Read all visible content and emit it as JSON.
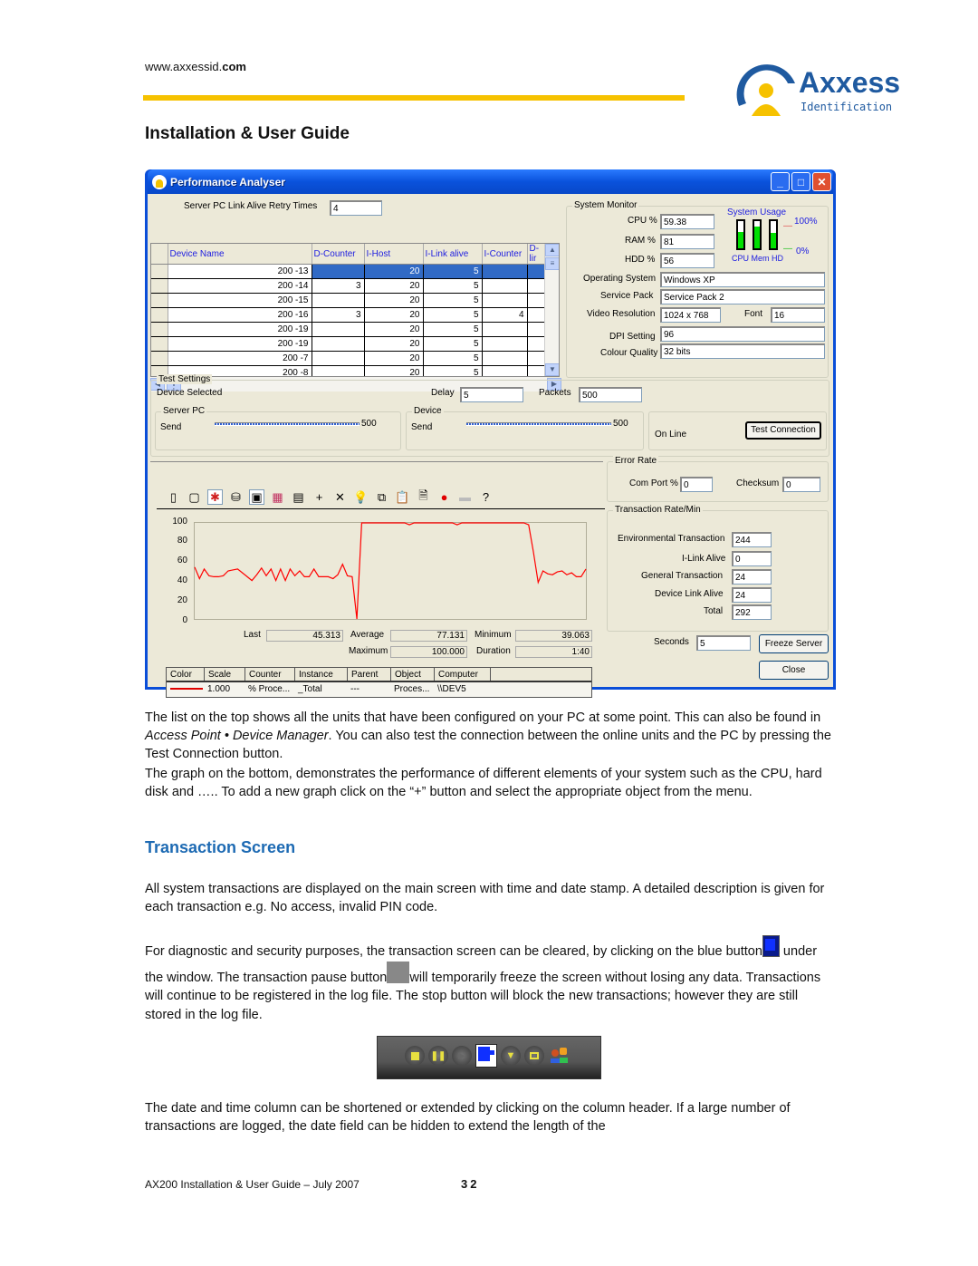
{
  "header": {
    "url_prefix": "www.axxessid.",
    "url_suffix": "com",
    "logo_name": "Axxess",
    "logo_sub": "Identification",
    "section_title": "Installation & User Guide"
  },
  "window": {
    "title": "Performance Analyser",
    "link_alive_label": "Server PC  Link Alive Retry Times",
    "link_alive_value": "4",
    "grid": {
      "columns": [
        "Device Name",
        "D-Counter",
        "I-Host",
        "I-Link alive",
        "I-Counter",
        "D-lir"
      ],
      "rows": [
        {
          "name": "200 -13",
          "d_counter": "",
          "i_host": "20",
          "i_link": "5",
          "i_counter": "",
          "selected": true
        },
        {
          "name": "200 -14",
          "d_counter": "3",
          "i_host": "20",
          "i_link": "5",
          "i_counter": ""
        },
        {
          "name": "200 -15",
          "d_counter": "",
          "i_host": "20",
          "i_link": "5",
          "i_counter": ""
        },
        {
          "name": "200 -16",
          "d_counter": "3",
          "i_host": "20",
          "i_link": "5",
          "i_counter": "4"
        },
        {
          "name": "200 -19",
          "d_counter": "",
          "i_host": "20",
          "i_link": "5",
          "i_counter": ""
        },
        {
          "name": "200 -19",
          "d_counter": "",
          "i_host": "20",
          "i_link": "5",
          "i_counter": ""
        },
        {
          "name": "200 -7",
          "d_counter": "",
          "i_host": "20",
          "i_link": "5",
          "i_counter": ""
        },
        {
          "name": "200 -8",
          "d_counter": "",
          "i_host": "20",
          "i_link": "5",
          "i_counter": ""
        }
      ]
    },
    "system_monitor": {
      "title": "System Monitor",
      "cpu_label": "CPU %",
      "cpu_value": "59.38",
      "ram_label": "RAM %",
      "ram_value": "81",
      "hdd_label": "HDD %",
      "hdd_value": "56",
      "os_label": "Operating System",
      "os_value": "Windows XP",
      "sp_label": "Service Pack",
      "sp_value": "Service Pack 2",
      "res_label": "Video Resolution",
      "res_value": "1024 x  768",
      "font_label": "Font",
      "font_value": "16",
      "dpi_label": "DPI Setting",
      "dpi_value": "96",
      "colour_label": "Colour Quality",
      "colour_value": "32 bits",
      "usage_title": "System Usage",
      "usage_max": "100%",
      "usage_min": "0%",
      "usage_labels": "CPU Mem HD",
      "usage_cpu_pct": 59,
      "usage_mem_pct": 81,
      "usage_hd_pct": 56
    },
    "test_settings": {
      "title": "Test Settings",
      "device_selected": "Device Selected",
      "delay_label": "Delay",
      "delay_value": "5",
      "packets_label": "Packets",
      "packets_value": "500",
      "server_title": "Server PC",
      "server_send": "Send",
      "server_send_value": "500",
      "device_title": "Device",
      "device_send": "Send",
      "device_send_value": "500",
      "status": "On Line",
      "test_button": "Test Connection"
    },
    "error_rate": {
      "title": "Error Rate",
      "com_label": "Com Port %",
      "com_value": "0",
      "checksum_label": "Checksum",
      "checksum_value": "0"
    },
    "transaction_rate": {
      "title": "Transaction Rate/Min",
      "env_label": "Environmental Transaction",
      "env_value": "244",
      "ilink_label": "I-Link Alive",
      "ilink_value": "0",
      "general_label": "General Transaction",
      "general_value": "24",
      "device_label": "Device Link Alive",
      "device_value": "24",
      "total_label": "Total",
      "total_value": "292"
    },
    "seconds_label": "Seconds",
    "seconds_value": "5",
    "freeze_button": "Freeze Server",
    "close_button": "Close",
    "stats": {
      "last_label": "Last",
      "last_value": "45.313",
      "average_label": "Average",
      "average_value": "77.131",
      "minimum_label": "Minimum",
      "minimum_value": "39.063",
      "maximum_label": "Maximum",
      "maximum_value": "100.000",
      "duration_label": "Duration",
      "duration_value": "1:40"
    },
    "legend": {
      "headers": [
        "Color",
        "Scale",
        "Counter",
        "Instance",
        "Parent",
        "Object",
        "Computer"
      ],
      "row": {
        "scale": "1.000",
        "counter": "% Proce...",
        "instance": "_Total",
        "parent": "---",
        "object": "Proces...",
        "computer": "\\\\DEV5"
      }
    }
  },
  "chart_data": {
    "type": "line",
    "title": "",
    "xlabel": "",
    "ylabel": "",
    "ylim": [
      0,
      100
    ],
    "yticks": [
      100,
      80,
      60,
      40,
      20,
      0
    ],
    "series": [
      {
        "name": "% Processor Time _Total",
        "color": "#ff0000",
        "values": [
          54,
          42,
          52,
          45,
          44,
          44,
          45,
          50,
          51,
          52,
          48,
          44,
          40,
          46,
          53,
          45,
          52,
          40,
          52,
          40,
          52,
          45,
          50,
          44,
          44,
          52,
          44,
          44,
          44,
          42,
          46,
          57,
          45,
          44,
          0,
          100,
          100,
          100,
          100,
          100,
          100,
          100,
          100,
          100,
          100,
          98,
          100,
          100,
          100,
          100,
          100,
          100,
          100,
          100,
          100,
          98,
          100,
          100,
          100,
          100,
          100,
          100,
          100,
          100,
          100,
          100,
          100,
          100,
          100,
          100,
          98,
          70,
          38,
          50,
          47,
          46,
          49,
          50,
          46,
          48,
          44,
          44,
          52
        ]
      }
    ]
  },
  "body": {
    "para1_a": "The list on the top shows all the units that have been configured on your PC at some point. This can also be found in ",
    "para1_italic": "Access Point • Device Manager",
    "para1_b": ". You can also test the connection between the online units and the PC by pressing the Test Connection button.",
    "para2": "The graph on the bottom, demonstrates the performance of different elements of your system such as the CPU, hard disk and ….. To add a new graph click on the “+” button and select the appropriate object from the menu.",
    "heading2": "Transaction Screen",
    "para3": "All system transactions are displayed on the main screen with time and date stamp.  A detailed description is given for each transaction e.g. No access, invalid PIN code.",
    "para4_a": "For diagnostic and security purposes, the transaction screen can be cleared, by clicking on the blue button",
    "para4_b": " under the window. The transaction pause button",
    "para4_c": "will temporarily freeze the screen without losing any data. Transactions will continue to be registered in the log file. The stop button will block the new transactions; however they are still stored in the log file.",
    "para5": "The date and time column can be shortened or extended by clicking on the column header. If a large number of transactions are logged, the date field can be hidden to extend the length of the"
  },
  "footer": {
    "text": "AX200 Installation & User Guide – July 2007",
    "page": "32"
  }
}
